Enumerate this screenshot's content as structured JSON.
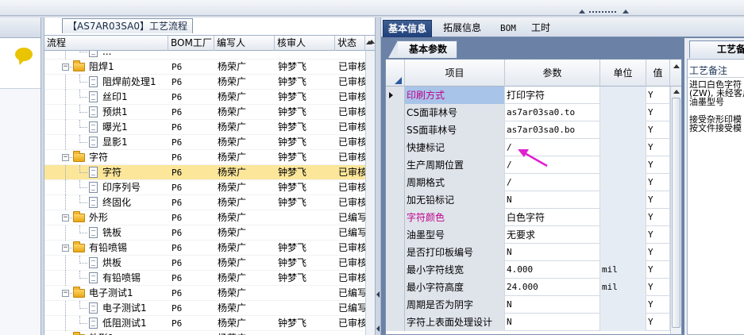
{
  "tree": {
    "title": "【AS7AR03SA0】工艺流程",
    "columns": [
      "流程",
      "BOM工厂",
      "编写人",
      "核审人",
      "状态"
    ],
    "rows": [
      {
        "level": 2,
        "type": "doc",
        "name": "...",
        "factory": "",
        "writer": "",
        "reviewer": "",
        "status": "",
        "partial": true
      },
      {
        "level": 1,
        "type": "folder",
        "expanded": true,
        "name": "阻焊1",
        "factory": "P6",
        "writer": "杨荣广",
        "reviewer": "钟梦飞",
        "status": "已审核"
      },
      {
        "level": 2,
        "type": "doc",
        "name": "阻焊前处理1",
        "factory": "P6",
        "writer": "杨荣广",
        "reviewer": "钟梦飞",
        "status": "已审核"
      },
      {
        "level": 2,
        "type": "doc",
        "name": "丝印1",
        "factory": "P6",
        "writer": "杨荣广",
        "reviewer": "钟梦飞",
        "status": "已审核"
      },
      {
        "level": 2,
        "type": "doc",
        "name": "预烘1",
        "factory": "P6",
        "writer": "杨荣广",
        "reviewer": "钟梦飞",
        "status": "已审核"
      },
      {
        "level": 2,
        "type": "doc",
        "name": "曝光1",
        "factory": "P6",
        "writer": "杨荣广",
        "reviewer": "钟梦飞",
        "status": "已审核"
      },
      {
        "level": 2,
        "type": "doc",
        "name": "显影1",
        "factory": "P6",
        "writer": "杨荣广",
        "reviewer": "钟梦飞",
        "status": "已审核"
      },
      {
        "level": 1,
        "type": "folder",
        "expanded": true,
        "name": "字符",
        "factory": "P6",
        "writer": "杨荣广",
        "reviewer": "钟梦飞",
        "status": "已审核"
      },
      {
        "level": 2,
        "type": "doc",
        "name": "字符",
        "factory": "P6",
        "writer": "杨荣广",
        "reviewer": "钟梦飞",
        "status": "已审核",
        "selected": true
      },
      {
        "level": 2,
        "type": "doc",
        "name": "印序列号",
        "factory": "P6",
        "writer": "杨荣广",
        "reviewer": "钟梦飞",
        "status": "已审核"
      },
      {
        "level": 2,
        "type": "doc",
        "name": "终固化",
        "factory": "P6",
        "writer": "杨荣广",
        "reviewer": "钟梦飞",
        "status": "已审核"
      },
      {
        "level": 1,
        "type": "folder",
        "expanded": true,
        "name": "外形",
        "factory": "P6",
        "writer": "杨荣广",
        "reviewer": "",
        "status": "已编写"
      },
      {
        "level": 2,
        "type": "doc",
        "name": "铣板",
        "factory": "P6",
        "writer": "杨荣广",
        "reviewer": "",
        "status": "已编写"
      },
      {
        "level": 1,
        "type": "folder",
        "expanded": true,
        "name": "有铅喷锡",
        "factory": "P6",
        "writer": "杨荣广",
        "reviewer": "钟梦飞",
        "status": "已审核"
      },
      {
        "level": 2,
        "type": "doc",
        "name": "烘板",
        "factory": "P6",
        "writer": "杨荣广",
        "reviewer": "钟梦飞",
        "status": "已审核"
      },
      {
        "level": 2,
        "type": "doc",
        "name": "有铅喷锡",
        "factory": "P6",
        "writer": "杨荣广",
        "reviewer": "钟梦飞",
        "status": "已审核"
      },
      {
        "level": 1,
        "type": "folder",
        "expanded": true,
        "name": "电子测试1",
        "factory": "P6",
        "writer": "杨荣广",
        "reviewer": "",
        "status": "已编写"
      },
      {
        "level": 2,
        "type": "doc",
        "name": "电子测试1",
        "factory": "P6",
        "writer": "杨荣广",
        "reviewer": "",
        "status": "已编写"
      },
      {
        "level": 2,
        "type": "doc",
        "name": "低阻测试1",
        "factory": "P6",
        "writer": "杨荣广",
        "reviewer": "钟梦飞",
        "status": "已审核"
      },
      {
        "level": 1,
        "type": "folder",
        "expanded": true,
        "name": "外形1",
        "factory": "P6",
        "writer": "杨荣广",
        "reviewer": "",
        "status": "",
        "partial": true
      }
    ]
  },
  "tabs": [
    {
      "label": "基本信息",
      "active": true
    },
    {
      "label": "拓展信息",
      "active": false
    },
    {
      "label": "BOM",
      "active": false
    },
    {
      "label": "工时",
      "active": false
    }
  ],
  "params": {
    "subtab": "基本参数",
    "columns": [
      "项目",
      "参数",
      "单位",
      "值"
    ],
    "rows": [
      {
        "item": "印刷方式",
        "value": "打印字符",
        "unit": "",
        "flag": "Y",
        "highlight": true,
        "current": true
      },
      {
        "item": "CS面菲林号",
        "value": "as7ar03sa0.to",
        "unit": "",
        "flag": "Y",
        "mono": true
      },
      {
        "item": "SS面菲林号",
        "value": "as7ar03sa0.bo",
        "unit": "",
        "flag": "Y",
        "mono": true
      },
      {
        "item": "快捷标记",
        "value": "/",
        "unit": "",
        "flag": "Y"
      },
      {
        "item": "生产周期位置",
        "value": "/",
        "unit": "",
        "flag": "Y"
      },
      {
        "item": "周期格式",
        "value": "/",
        "unit": "",
        "flag": "Y"
      },
      {
        "item": "加无铅标记",
        "value": "N",
        "unit": "",
        "flag": "Y"
      },
      {
        "item": "字符颜色",
        "value": "白色字符",
        "unit": "",
        "flag": "Y",
        "highlight": true
      },
      {
        "item": "油墨型号",
        "value": "无要求",
        "unit": "",
        "flag": "Y"
      },
      {
        "item": "是否打印板编号",
        "value": "N",
        "unit": "",
        "flag": "Y"
      },
      {
        "item": "最小字符线宽",
        "value": "4.000",
        "unit": "mil",
        "flag": "Y"
      },
      {
        "item": "最小字符高度",
        "value": "24.000",
        "unit": "mil",
        "flag": "Y"
      },
      {
        "item": "周期是否为阴字",
        "value": "N",
        "unit": "",
        "flag": "Y"
      },
      {
        "item": "字符上表面处理设计",
        "value": "N",
        "unit": "",
        "flag": "Y"
      }
    ]
  },
  "notes": {
    "tab": "工艺备注",
    "label": "工艺备注",
    "text": "进口白色字符\n(ZW), 未经客户\n油墨型号\n\n接受杂形印模\n按文件接受模"
  },
  "colors": {
    "accent": "#c0008a",
    "selection": "#fbe69a",
    "active_tab": "#20407a",
    "arrow": "#e020d0"
  }
}
